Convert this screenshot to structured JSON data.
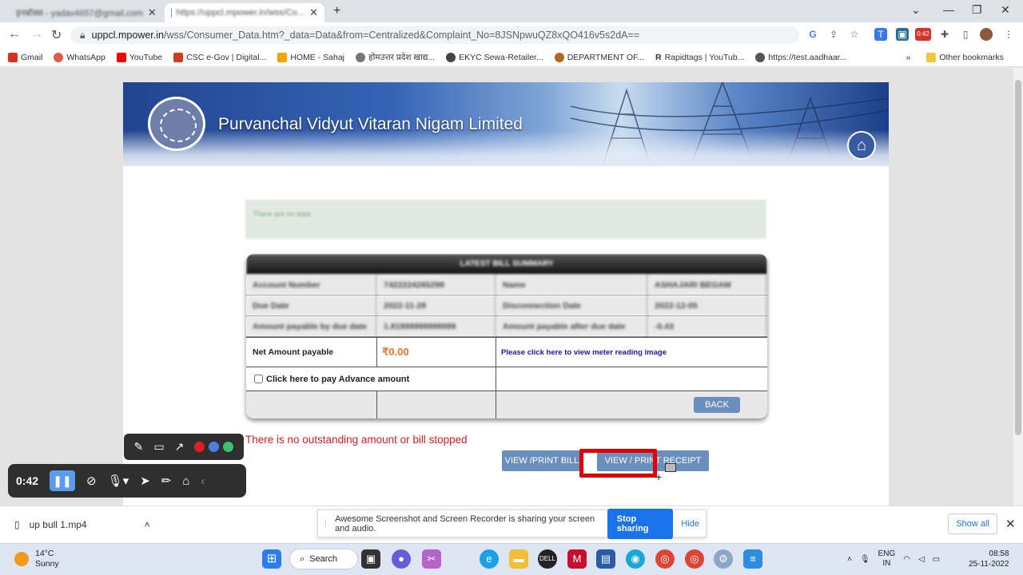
{
  "browser": {
    "tabs": [
      {
        "label": "इनबॉक्स - yadav4657@gmail.com",
        "active": false
      },
      {
        "label": "https://uppcl.mpower.in/wss/Co...",
        "active": true
      }
    ],
    "new_tab": "+",
    "window_controls": {
      "minimize": "—",
      "maximize": "❐",
      "close": "✕",
      "dropdown": "⌄"
    },
    "url_host": "uppcl.mpower.in",
    "url_path": "/wss/Consumer_Data.htm?_data=Data&from=Centralized&Complaint_No=8JSNpwuQZ8xQO416v5s2dA==",
    "recorder_badge": "0:42",
    "bookmarks": [
      {
        "label": "Gmail",
        "color": "#d93025"
      },
      {
        "label": "WhatsApp",
        "color": "#e05a4a"
      },
      {
        "label": "YouTube",
        "color": "#ff0000"
      },
      {
        "label": "CSC e-Gov | Digital...",
        "color": "#d04020"
      },
      {
        "label": "HOME - Sahaj",
        "color": "#f2a400"
      },
      {
        "label": "होमउत्तर प्रदेश खाद्य...",
        "color": "#777777"
      },
      {
        "label": "EKYC Sewa-Retailer...",
        "color": "#444444"
      },
      {
        "label": "DEPARTMENT OF...",
        "color": "#b5651d"
      },
      {
        "label": "Rapidtags | YouTub...",
        "color": "#111111"
      },
      {
        "label": "https://test.aadhaar...",
        "color": "#555555"
      }
    ],
    "bookmarks_more": "»",
    "other_bookmarks": "Other bookmarks"
  },
  "page": {
    "org_name": "Purvanchal Vidyut Vitaran Nigam Limited",
    "info_text": "There are no data",
    "bill_summary_title": "LATEST BILL SUMMARY",
    "rows": [
      [
        "Account Number",
        "7422224265299",
        "Name",
        "ASHAJARI BEGAM"
      ],
      [
        "Due Date",
        "2022-11-28",
        "Disconnection Date",
        "2022-12-05"
      ],
      [
        "Amount payable by due date",
        "1.81999999999999",
        "Amount payable after due date",
        "-0.43"
      ]
    ],
    "net_amount_label": "Net Amount payable",
    "net_amount_value": "₹0.00",
    "meter_link": "Please click here to view meter reading image",
    "advance_label": "Click here to pay Advance amount",
    "back_button": "BACK",
    "outstanding_msg": "There is no outstanding amount or bill stopped",
    "view_print_bill": "VIEW /PRINT BILL",
    "view_print_receipt": "VIEW / PRINT RECEIPT"
  },
  "recorder": {
    "timer": "0:42",
    "colors": [
      "#e02020",
      "#4a7fe0",
      "#3cc070"
    ]
  },
  "downloads": {
    "file_name": "up bull 1.mp4",
    "share_message": "Awesome Screenshot and Screen Recorder is sharing your screen and audio.",
    "stop_sharing": "Stop sharing",
    "hide": "Hide",
    "show_all": "Show all"
  },
  "taskbar": {
    "temperature": "14°C",
    "weather": "Sunny",
    "search": "Search",
    "language": "ENG",
    "region": "IN",
    "time": "08:58",
    "date": "25-11-2022"
  }
}
